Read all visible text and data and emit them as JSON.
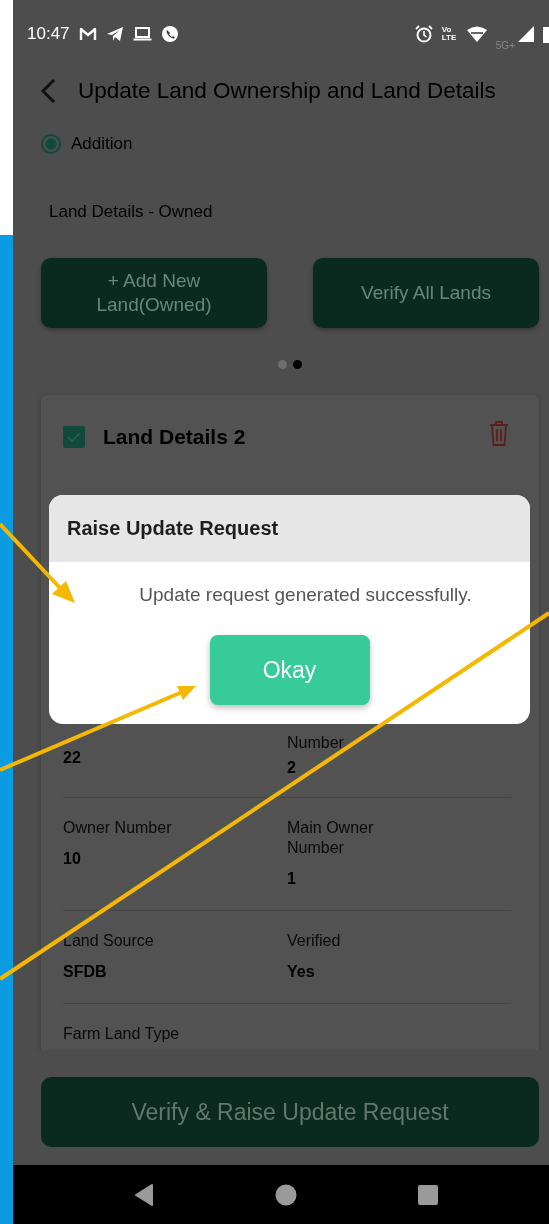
{
  "status_bar": {
    "time": "10:47",
    "volte": "Vo LTE",
    "network": "5G+"
  },
  "header": {
    "title": "Update Land Ownership and Land Details"
  },
  "radio": {
    "label": "Addition",
    "selected": true
  },
  "section_title": "Land Details - Owned",
  "action_buttons": [
    "+ Add New Land(Owned)",
    "Verify All Lands"
  ],
  "pager": [
    {
      "selected": false
    },
    {
      "selected": true
    }
  ],
  "card": {
    "title": "Land Details 2",
    "checked": true,
    "rows": [
      [
        {
          "value": "22"
        },
        {
          "label": "Number",
          "value": "2"
        }
      ],
      [
        {
          "label": "Owner Number",
          "value": "10"
        },
        {
          "label": "Main Owner Number",
          "value": "1"
        }
      ],
      [
        {
          "label": "Land Source",
          "value": "SFDB"
        },
        {
          "label": "Verified",
          "value": "Yes"
        }
      ],
      [
        {
          "label": "Farm Land Type"
        }
      ]
    ]
  },
  "submit_button": "Verify & Raise Update Request",
  "dialog": {
    "title": "Raise Update Request",
    "message": "Update request generated successfully.",
    "button": "Okay"
  }
}
